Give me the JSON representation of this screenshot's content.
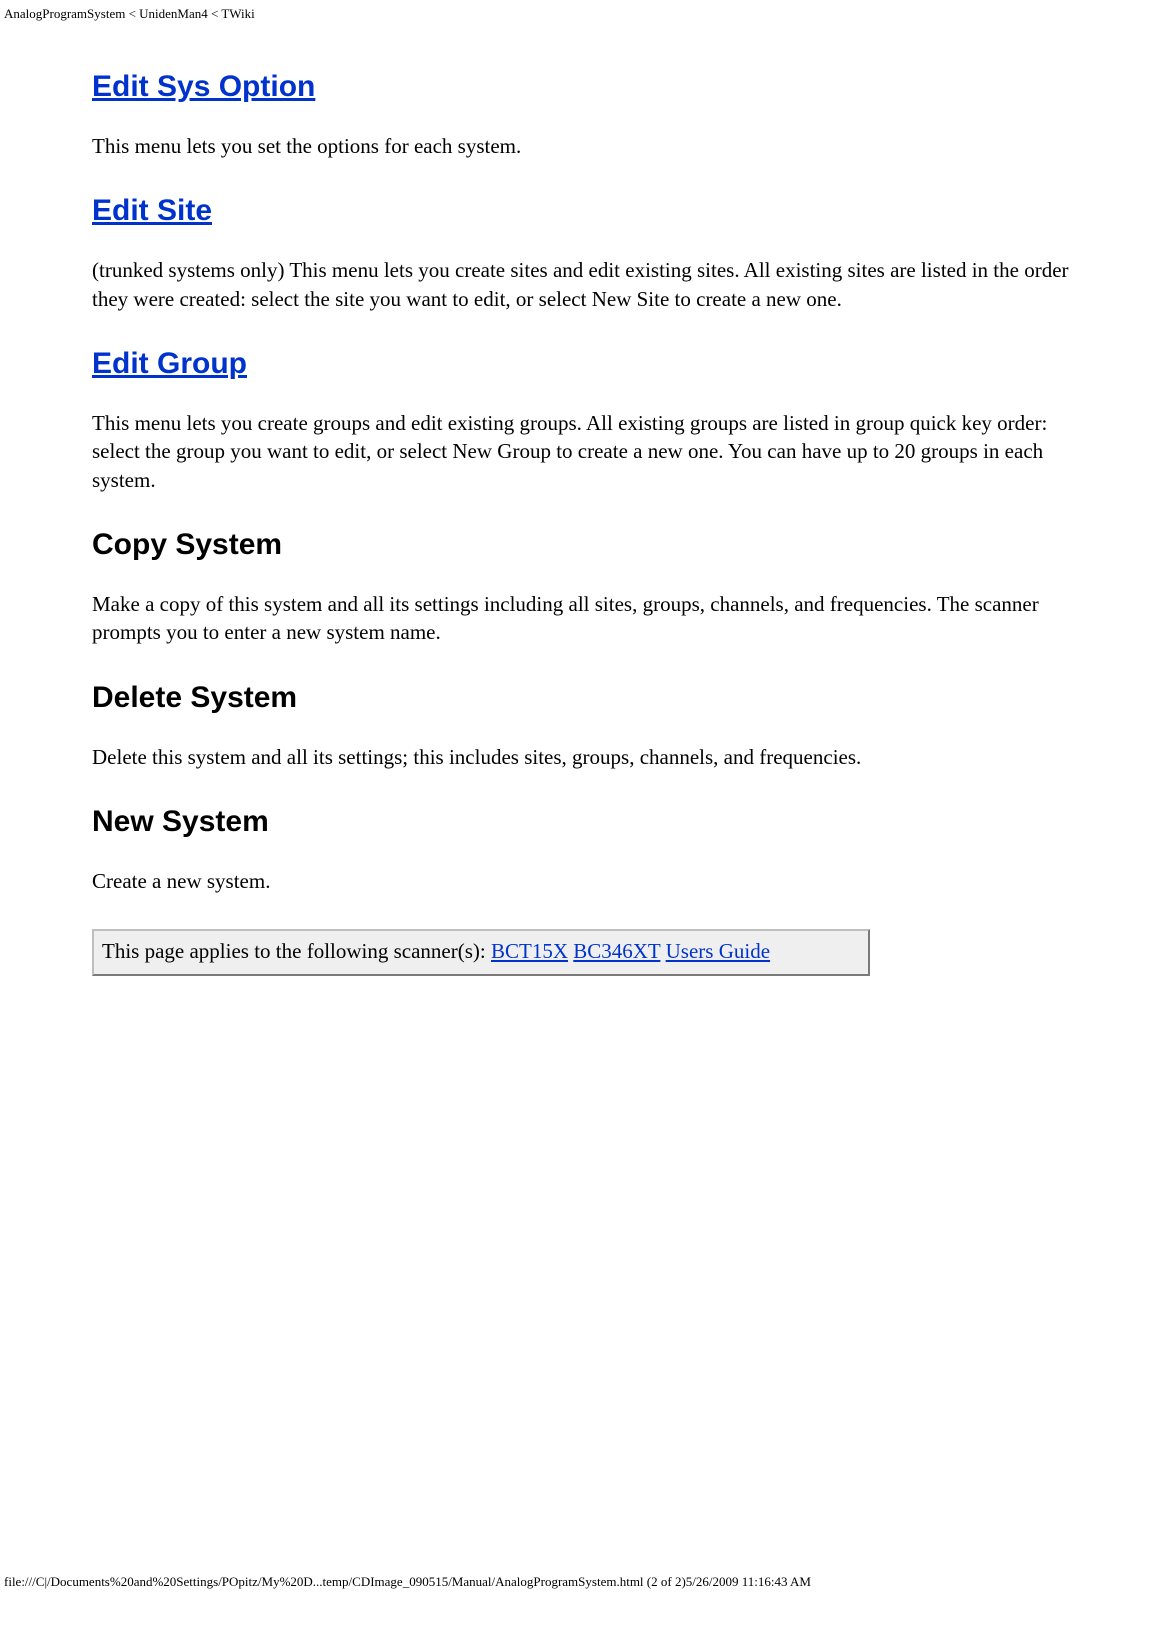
{
  "header_path": "AnalogProgramSystem < UnidenMan4 < TWiki",
  "sections": {
    "edit_sys_option": {
      "heading": "Edit Sys Option",
      "body": "This menu lets you set the options for each system."
    },
    "edit_site": {
      "heading": "Edit Site",
      "body": "(trunked systems only) This menu lets you create sites and edit existing sites. All existing sites are listed in the order they were created: select the site you want to edit, or select New Site to create a new one."
    },
    "edit_group": {
      "heading": "Edit Group",
      "body": "This menu lets you create groups and edit existing groups. All existing groups are listed in group quick key order: select the group you want to edit, or select New Group to create a new one. You can have up to 20 groups in each system."
    },
    "copy_system": {
      "heading": "Copy System",
      "body": "Make a copy of this system and all its settings including all sites, groups, channels, and frequencies. The scanner prompts you to enter a new system name."
    },
    "delete_system": {
      "heading": "Delete System",
      "body": "Delete this system and all its settings; this includes sites, groups, channels, and frequencies."
    },
    "new_system": {
      "heading": "New System",
      "body": "Create a new system."
    }
  },
  "applies_box": {
    "prefix": "This page applies to the following scanner(s): ",
    "links": [
      "BCT15X",
      "BC346XT",
      "Users Guide"
    ]
  },
  "footer": "file:///C|/Documents%20and%20Settings/POpitz/My%20D...temp/CDImage_090515/Manual/AnalogProgramSystem.html (2 of 2)5/26/2009 11:16:43 AM"
}
